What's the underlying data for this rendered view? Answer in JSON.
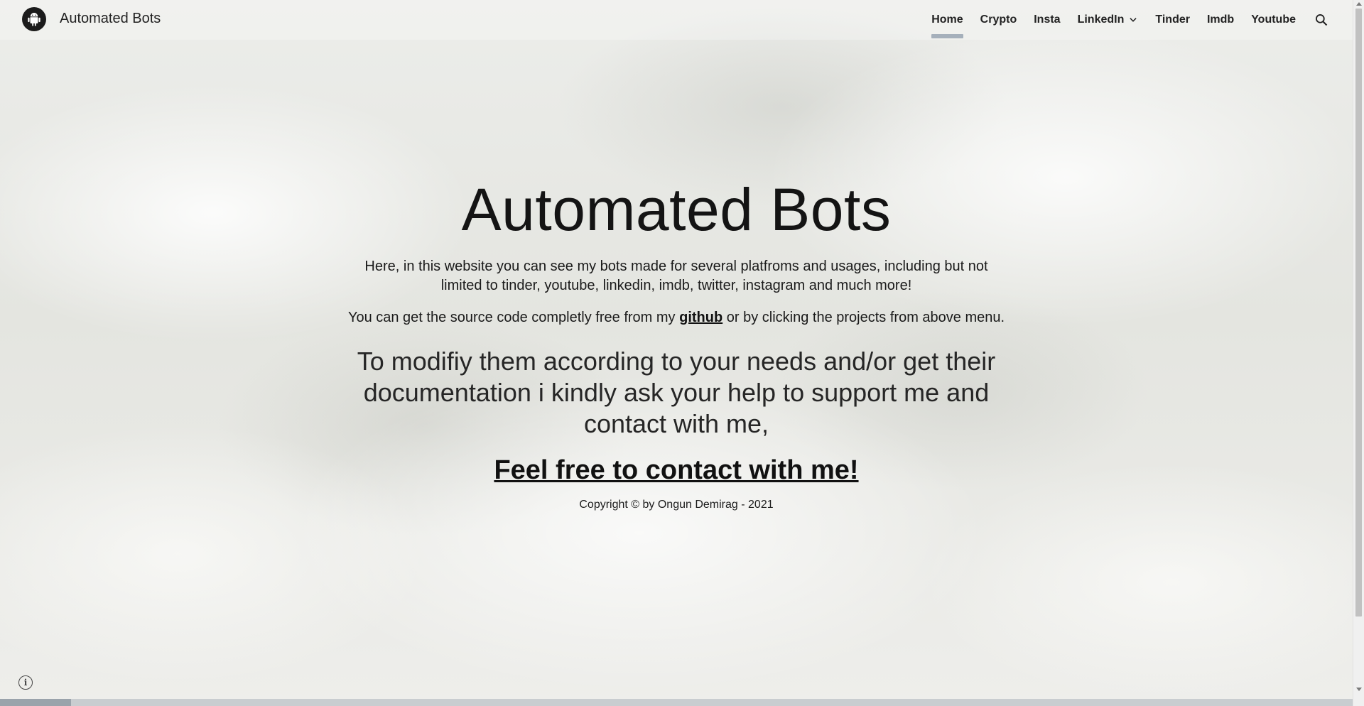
{
  "header": {
    "site_title": "Automated Bots",
    "logo_icon": "android-icon",
    "nav": [
      {
        "label": "Home",
        "active": true
      },
      {
        "label": "Crypto"
      },
      {
        "label": "Insta"
      },
      {
        "label": "LinkedIn",
        "dropdown": true
      },
      {
        "label": "Tinder"
      },
      {
        "label": "Imdb"
      },
      {
        "label": "Youtube"
      }
    ],
    "search_icon": "search-icon"
  },
  "main": {
    "title": "Automated Bots",
    "intro": "Here, in this website you can see my bots made for several platfroms and usages, including but not limited to tinder, youtube, linkedin, imdb, twitter, instagram and much more!",
    "source_prefix": "You can get the source code completly free from my ",
    "source_link": "github",
    "source_suffix": " or by clicking the projects from above menu.",
    "support_text": "To modifiy them according to your needs and/or get their documentation i kindly ask your help to support me and contact with me,",
    "contact_link": "Feel free to contact with me!",
    "copyright": "Copyright © by Ongun Demirag - 2021"
  },
  "footer": {
    "info_icon": "info-icon",
    "info_glyph": "i"
  },
  "colors": {
    "active_indicator": "#a5b0bb",
    "text": "#212121"
  }
}
